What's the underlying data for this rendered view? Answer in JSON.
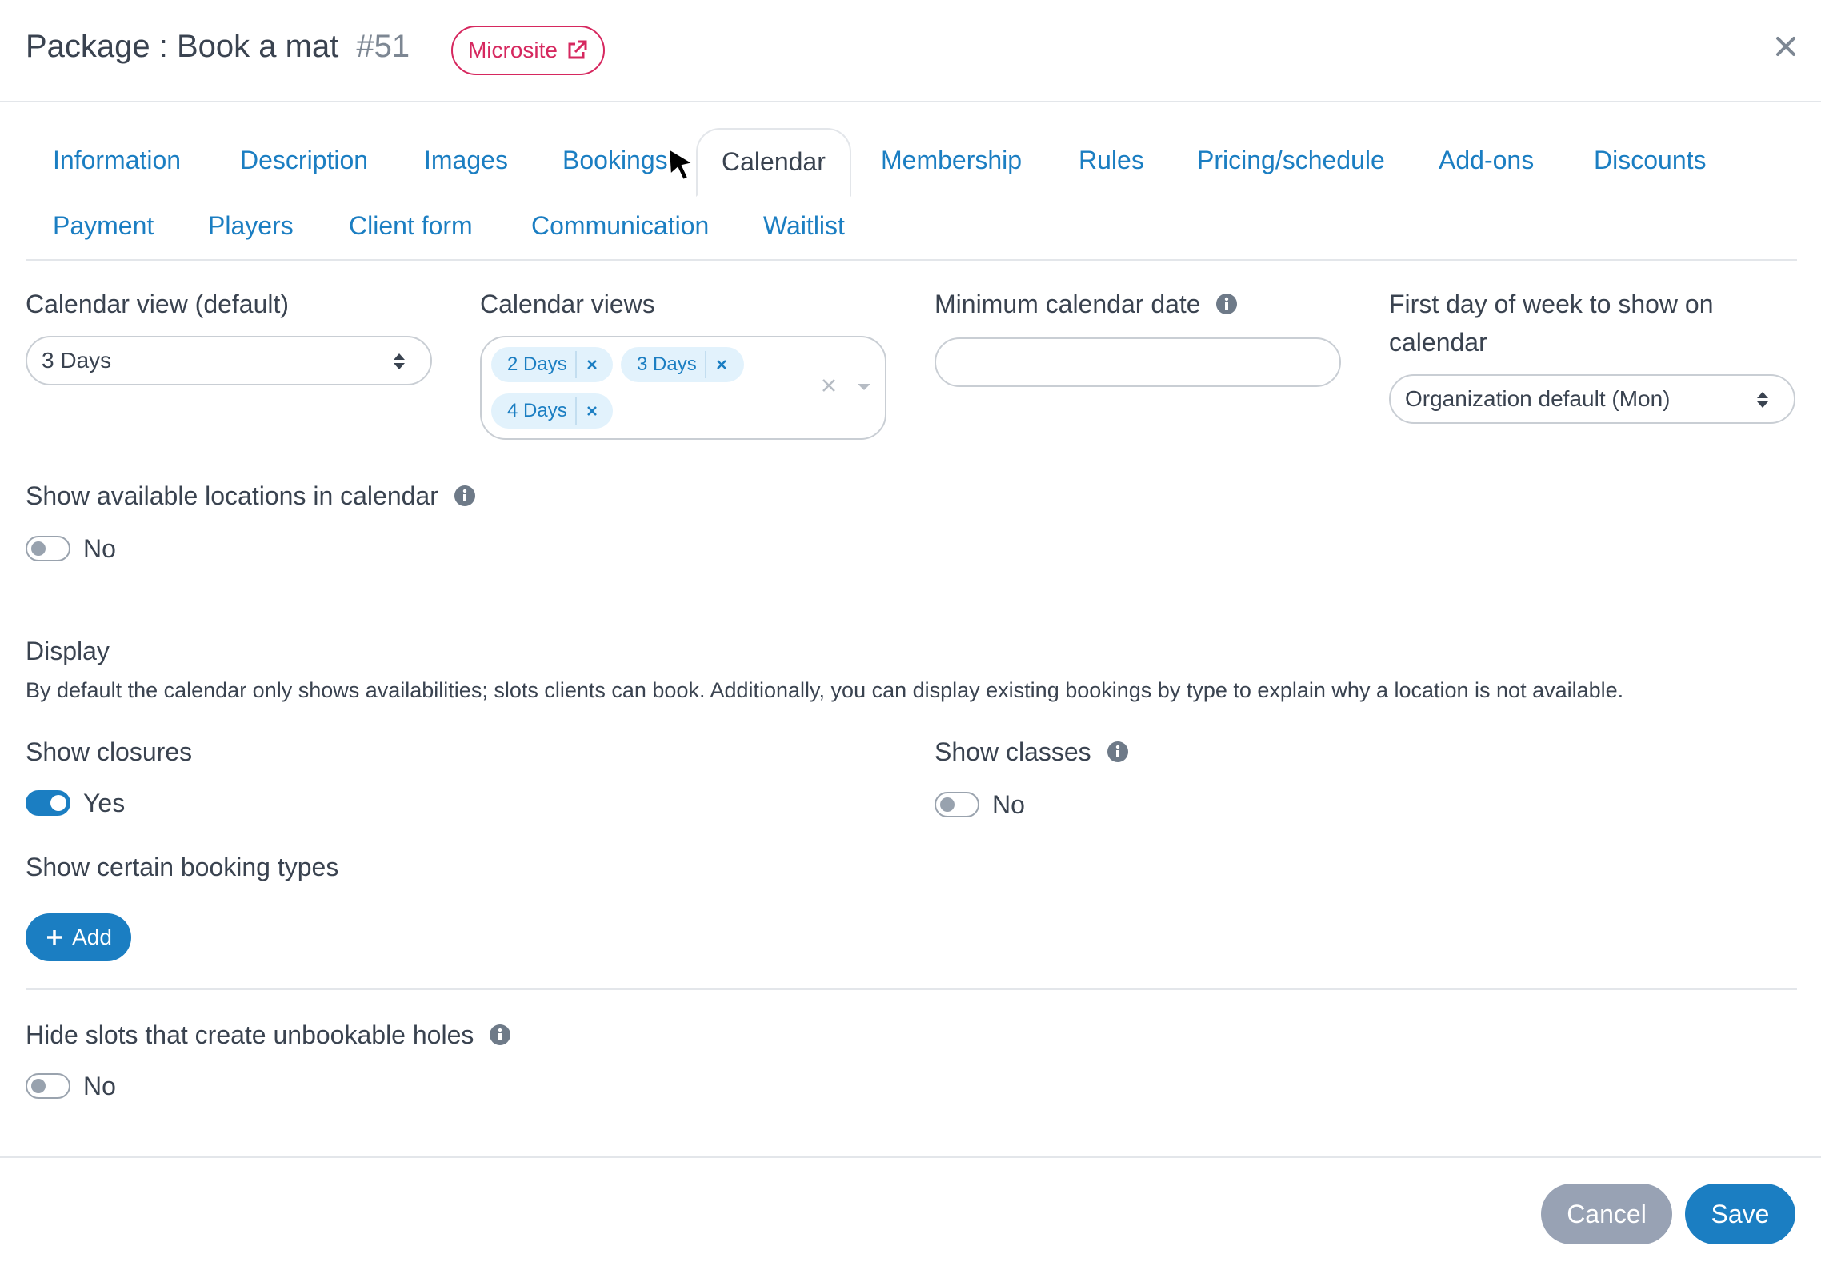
{
  "header": {
    "title": "Package : Book a mat",
    "package_id": "#51",
    "microsite_label": "Microsite",
    "microsite_icon": "external-link-icon",
    "close_icon": "close-icon"
  },
  "tabs": [
    {
      "label": "Information",
      "active": false
    },
    {
      "label": "Description",
      "active": false
    },
    {
      "label": "Images",
      "active": false
    },
    {
      "label": "Bookings",
      "active": false
    },
    {
      "label": "Calendar",
      "active": true
    },
    {
      "label": "Membership",
      "active": false
    },
    {
      "label": "Rules",
      "active": false
    },
    {
      "label": "Pricing/schedule",
      "active": false
    },
    {
      "label": "Add-ons",
      "active": false
    },
    {
      "label": "Discounts",
      "active": false
    },
    {
      "label": "Payment",
      "active": false
    },
    {
      "label": "Players",
      "active": false
    },
    {
      "label": "Client form",
      "active": false
    },
    {
      "label": "Communication",
      "active": false
    },
    {
      "label": "Waitlist",
      "active": false
    }
  ],
  "fields": {
    "calendar_view_default": {
      "label": "Calendar view (default)",
      "value": "3 Days"
    },
    "calendar_views": {
      "label": "Calendar views",
      "selected": [
        "2 Days",
        "3 Days",
        "4 Days"
      ]
    },
    "minimum_calendar_date": {
      "label": "Minimum calendar date",
      "value": ""
    },
    "first_day_of_week": {
      "label_line1": "First day of week to show on",
      "label_line2": "calendar",
      "value": "Organization default (Mon)"
    },
    "show_available_locations": {
      "label": "Show available locations in calendar",
      "value": "No",
      "on": false
    }
  },
  "display": {
    "title": "Display",
    "description": "By default the calendar only shows availabilities; slots clients can book. Additionally, you can display existing bookings by type to explain why a location is not available.",
    "show_closures": {
      "label": "Show closures",
      "value": "Yes",
      "on": true
    },
    "show_classes": {
      "label": "Show classes",
      "value": "No",
      "on": false
    },
    "show_booking_types": {
      "label": "Show certain booking types"
    },
    "add_label": "Add"
  },
  "hide_slots": {
    "label": "Hide slots that create unbookable holes",
    "value": "No",
    "on": false
  },
  "footer": {
    "cancel_label": "Cancel",
    "save_label": "Save"
  },
  "colors": {
    "accent": "#1b7ec2",
    "microsite": "#d6285f",
    "cancel": "#98a2b4",
    "text": "#3a4350"
  }
}
